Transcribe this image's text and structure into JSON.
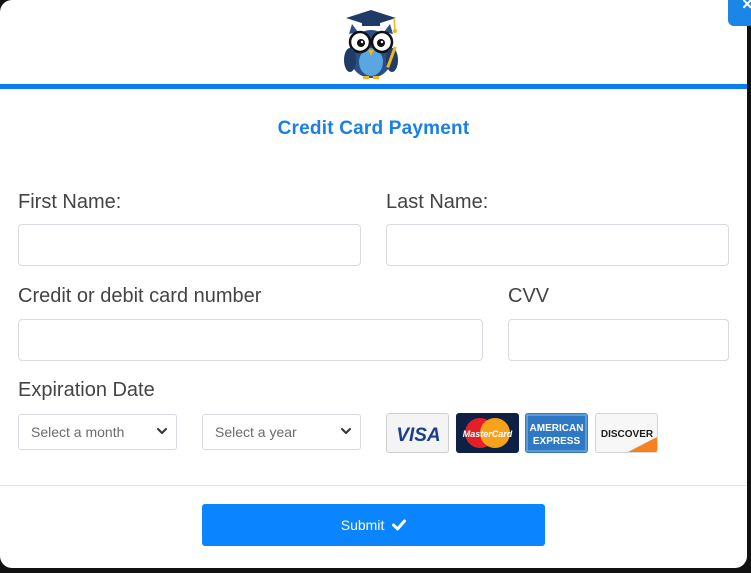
{
  "close_button": {
    "label": "×"
  },
  "form": {
    "title": "Credit Card Payment",
    "first_name": {
      "label": "First Name:",
      "value": "",
      "placeholder": ""
    },
    "last_name": {
      "label": "Last Name:",
      "value": "",
      "placeholder": ""
    },
    "card_number": {
      "label": "Credit or debit card number",
      "value": "",
      "placeholder": ""
    },
    "cvv": {
      "label": "CVV",
      "value": "",
      "placeholder": ""
    },
    "expiration": {
      "label": "Expiration Date",
      "month_selected": "Select a month",
      "year_selected": "Select a year"
    },
    "cards": {
      "visa": "VISA",
      "mastercard": "MasterCard",
      "amex_line1": "AMERICAN",
      "amex_line2": "EXPRESS",
      "discover": "DISCOVER"
    },
    "submit_label": "Submit"
  },
  "colors": {
    "accent": "#0a84ff",
    "title": "#1a7fe6",
    "header_rule": "#0b7ff0"
  },
  "icons": {
    "logo": "owl-graduate-icon",
    "close": "close-icon",
    "select_arrow": "chevron-down-icon",
    "submit": "check-icon"
  }
}
